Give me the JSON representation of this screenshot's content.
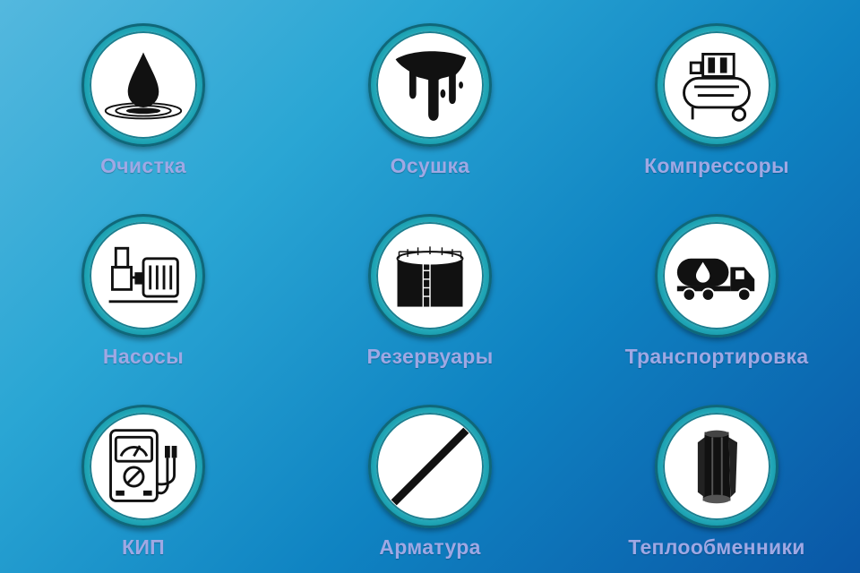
{
  "categories": [
    {
      "label": "Очистка",
      "icon": "water-drop-icon"
    },
    {
      "label": "Осушка",
      "icon": "oil-drip-icon"
    },
    {
      "label": "Компрессоры",
      "icon": "air-compressor-icon"
    },
    {
      "label": "Насосы",
      "icon": "water-pump-icon"
    },
    {
      "label": "Резервуары",
      "icon": "storage-tank-icon"
    },
    {
      "label": "Транспортировка",
      "icon": "tanker-truck-icon"
    },
    {
      "label": "КИП",
      "icon": "gauge-meter-icon"
    },
    {
      "label": "Арматура",
      "icon": "pipe-rod-icon"
    },
    {
      "label": "Теплообменники",
      "icon": "heat-exchanger-icon"
    }
  ],
  "colors": {
    "label": "#9fa8e4",
    "ring": "#3fcad8",
    "background_start": "#54b8de",
    "background_end": "#0a57a6"
  }
}
